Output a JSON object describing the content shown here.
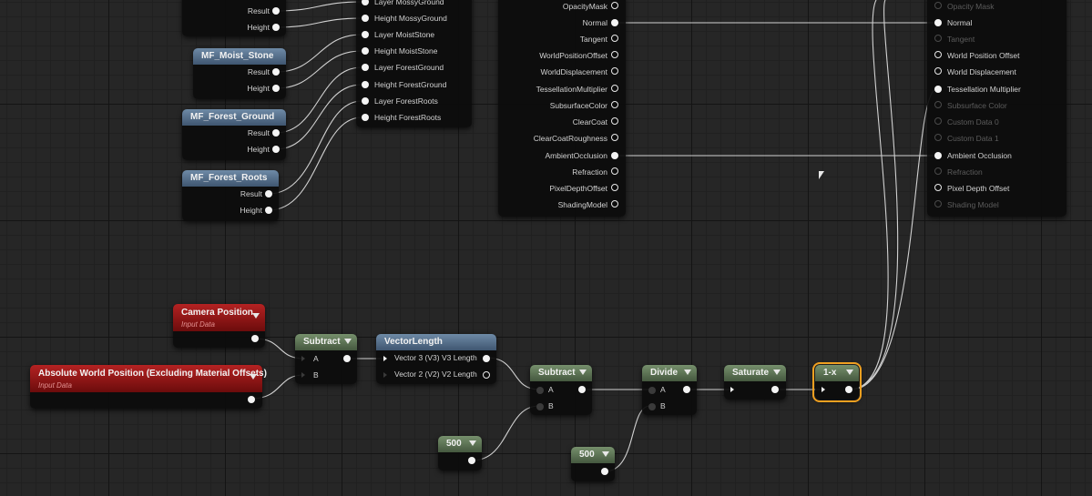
{
  "nodes": {
    "mf_moist_stone": {
      "title": "MF_Moist_Stone",
      "out1": "Result",
      "out2": "Height"
    },
    "mf_forest_ground": {
      "title": "MF_Forest_Ground",
      "out1": "Result",
      "out2": "Height"
    },
    "mf_forest_roots": {
      "title": "MF_Forest_Roots",
      "out1": "Result",
      "out2": "Height"
    },
    "top_partial": {
      "out1": "Result",
      "out2": "Height"
    },
    "blend_inputs": [
      "Layer MossyGround",
      "Height MossyGround",
      "Layer MoistStone",
      "Height MoistStone",
      "Layer ForestGround",
      "Height ForestGround",
      "Layer ForestRoots",
      "Height ForestRoots"
    ],
    "attributes_out": [
      "OpacityMask",
      "Normal",
      "Tangent",
      "WorldPositionOffset",
      "WorldDisplacement",
      "TessellationMultiplier",
      "SubsurfaceColor",
      "ClearCoat",
      "ClearCoatRoughness",
      "AmbientOcclusion",
      "Refraction",
      "PixelDepthOffset",
      "ShadingModel"
    ],
    "result_inputs": [
      "Opacity Mask",
      "Normal",
      "Tangent",
      "World Position Offset",
      "World Displacement",
      "Tessellation Multiplier",
      "Subsurface Color",
      "Custom Data 0",
      "Custom Data 1",
      "Ambient Occlusion",
      "Refraction",
      "Pixel Depth Offset",
      "Shading Model"
    ],
    "camera_position": {
      "title": "Camera Position",
      "subtitle": "Input Data"
    },
    "absolute_world_position": {
      "title": "Absolute World Position (Excluding Material Offsets)",
      "subtitle": "Input Data"
    },
    "subtract1": {
      "title": "Subtract",
      "in_a": "A",
      "in_b": "B"
    },
    "vector_length": {
      "title": "VectorLength",
      "in1": "Vector 3 (V3) V3 Length",
      "in2": "Vector 2 (V2) V2 Length"
    },
    "subtract2": {
      "title": "Subtract",
      "in_a": "A",
      "in_b": "B"
    },
    "divide": {
      "title": "Divide",
      "in_a": "A",
      "in_b": "B"
    },
    "saturate": {
      "title": "Saturate"
    },
    "one_minus": {
      "title": "1-x"
    },
    "const_500_a": {
      "value": "500"
    },
    "const_500_b": {
      "value": "500"
    }
  },
  "colors": {
    "background": "#262626",
    "function_header": "#4f6a86",
    "math_header": "#5a7350",
    "input_header": "#9a1515",
    "selection": "#f0a020",
    "wire": "#e6e6e6"
  }
}
